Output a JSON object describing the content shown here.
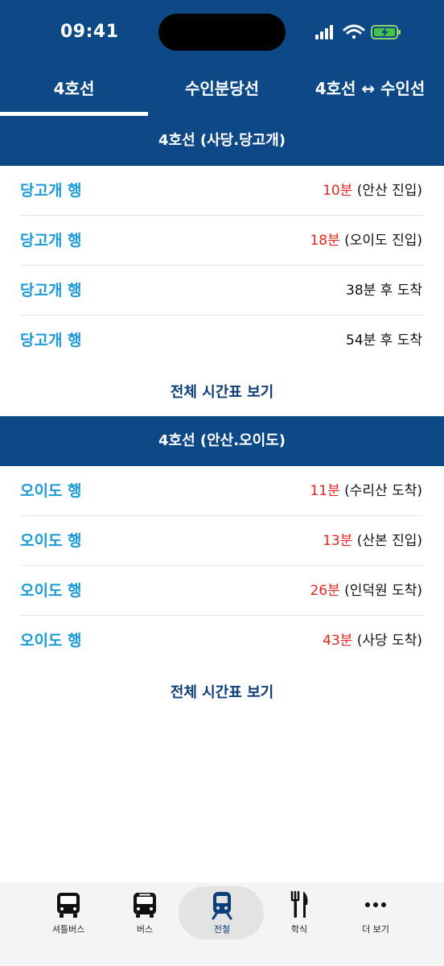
{
  "status": {
    "time": "09:41"
  },
  "tabs": [
    {
      "label": "4호선"
    },
    {
      "label": "수인분당선"
    },
    {
      "label": "4호선 ↔ 수인선"
    }
  ],
  "sections": [
    {
      "title": "4호선 (사당.당고개)",
      "rows": [
        {
          "dest": "당고개 행",
          "minutes": "10분",
          "note": " (안산 진입)"
        },
        {
          "dest": "당고개 행",
          "minutes": "18분",
          "note": " (오이도 진입)"
        },
        {
          "dest": "당고개 행",
          "minutes": "",
          "note": "38분 후 도착"
        },
        {
          "dest": "당고개 행",
          "minutes": "",
          "note": "54분 후 도착"
        }
      ],
      "full_link": "전체 시간표 보기"
    },
    {
      "title": "4호선 (안산.오이도)",
      "rows": [
        {
          "dest": "오이도 행",
          "minutes": "11분",
          "note": " (수리산 도착)"
        },
        {
          "dest": "오이도 행",
          "minutes": "13분",
          "note": " (산본 진입)"
        },
        {
          "dest": "오이도 행",
          "minutes": "26분",
          "note": " (인덕원 도착)"
        },
        {
          "dest": "오이도 행",
          "minutes": "43분",
          "note": " (사당 도착)"
        }
      ],
      "full_link": "전체 시간표 보기"
    }
  ],
  "bottom_nav": [
    {
      "label": "셔틀버스",
      "icon": "shuttle-bus-icon"
    },
    {
      "label": "버스",
      "icon": "bus-icon"
    },
    {
      "label": "전철",
      "icon": "subway-icon"
    },
    {
      "label": "학식",
      "icon": "fork-knife-icon"
    },
    {
      "label": "더 보기",
      "icon": "more-dots-icon"
    }
  ],
  "colors": {
    "primary": "#0d4987",
    "destination": "#1a9ad6",
    "minutes_highlight": "#e3261f",
    "link": "#0d3e7a"
  }
}
